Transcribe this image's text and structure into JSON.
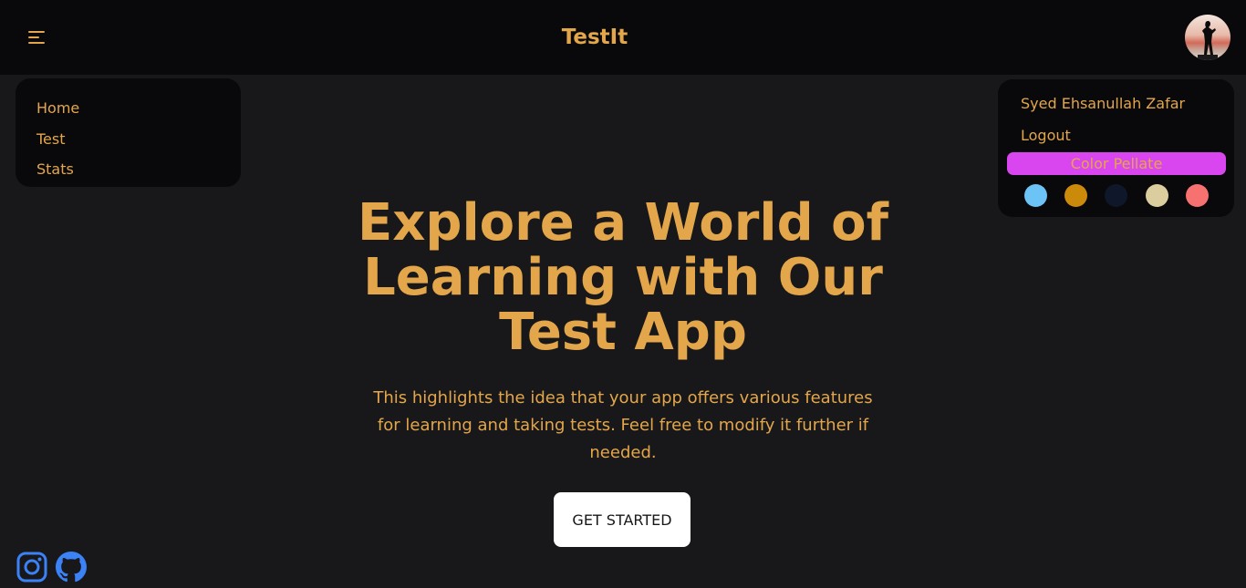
{
  "header": {
    "brand": "TestIt",
    "menu_icon": "hamburger-icon",
    "avatar_icon": "user-avatar"
  },
  "nav": {
    "items": [
      {
        "label": "Home"
      },
      {
        "label": "Test"
      },
      {
        "label": "Stats"
      }
    ]
  },
  "user_menu": {
    "name": "Syed Ehsanullah Zafar",
    "logout": "Logout",
    "palette_label": "Color Pellate",
    "swatches": [
      "#6cc3f5",
      "#cb8a0a",
      "#0f172a",
      "#dccd9e",
      "#f87171"
    ]
  },
  "hero": {
    "title": "Explore a World of Learning with Our Test App",
    "subtitle": "This highlights the idea that your app offers various features for learning and taking tests. Feel free to modify it further if needed.",
    "cta": "GET STARTED"
  },
  "footer": {
    "icons": [
      "instagram-icon",
      "github-icon"
    ],
    "icon_color": "#3b82f6"
  },
  "colors": {
    "accent": "#e3a64b",
    "background": "#18181b",
    "panel": "#09090b",
    "palette_highlight": "#d946ef"
  }
}
